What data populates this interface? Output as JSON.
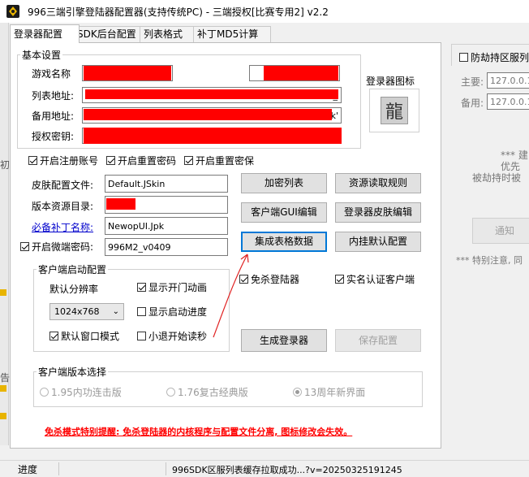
{
  "window": {
    "title": "996三端引擎登陆器配置器(支持传统PC) - 三端授权[比赛专用2] v2.2"
  },
  "tabs": [
    "登录器配置",
    "SDK后台配置",
    "列表格式",
    "补丁MD5计算"
  ],
  "basic": {
    "legend": "基本设置",
    "game_name_label": "游戏名称",
    "list_url_label": "列表地址:",
    "backup_url_label": "备用地址:",
    "auth_key_label": "授权密钥:",
    "icon_label": "登录器图标",
    "icon_glyph": "龍",
    "backup_url_tail": "k'",
    "list_url_tail": "_"
  },
  "checks_top": [
    {
      "label": "开启注册账号",
      "checked": true
    },
    {
      "label": "开启重置密码",
      "checked": true
    },
    {
      "label": "开启重置密保",
      "checked": true
    }
  ],
  "fields": {
    "skin_label": "皮肤配置文件:",
    "skin_value": "Default.JSkin",
    "res_label": "版本资源目录:",
    "patch_label": "必备补丁名称:",
    "patch_value": "NewopUI.Jpk",
    "micro_label": "开启微端密码:",
    "micro_value": "996M2_v0409",
    "micro_checked": true
  },
  "buttons": {
    "encrypt_list": "加密列表",
    "resource_rules": "资源读取规则",
    "gui_edit": "客户端GUI编辑",
    "skin_edit": "登录器皮肤编辑",
    "integrate_table": "集成表格数据",
    "plugin_default": "内挂默认配置",
    "generate": "生成登录器",
    "save_config": "保存配置"
  },
  "checks_right": [
    {
      "label": "免杀登陆器",
      "checked": true
    },
    {
      "label": "实名认证客户端",
      "checked": true
    }
  ],
  "startup": {
    "legend": "客户端启动配置",
    "resolution_label": "默认分辨率",
    "resolution_value": "1024x768",
    "window_mode": {
      "label": "默认窗口模式",
      "checked": true
    },
    "show_anim": {
      "label": "显示开门动画",
      "checked": true
    },
    "show_progress": {
      "label": "显示启动进度",
      "checked": false
    },
    "quick_exit": {
      "label": "小退开始读秒",
      "checked": false
    }
  },
  "version_select": {
    "legend": "客户端版本选择",
    "options": [
      "1.95内功连击版",
      "1.76复古经典版",
      "13周年新界面"
    ],
    "selected_index": 2
  },
  "warning": "免杀模式特别提醒: 免杀登陆器的内核程序与配置文件分离, 图标修改会失效。",
  "right_panel": {
    "anti_hijack_label": "防劫持区服列",
    "primary_label": "主要:",
    "primary_value": "127.0.0.1",
    "backup_label": "备用:",
    "backup_value": "127.0.0.1",
    "note_line1": "*** 建",
    "note_line2": "优先",
    "note_line3": "被劫持时被",
    "notify_button": "通知",
    "special_note": "*** 特别注意, 同"
  },
  "left_edge": {
    "text1": "初",
    "text2": "告"
  },
  "status": {
    "progress_label": "进度",
    "message": "996SDK区服列表缓存拉取成功...?v=20250325191245"
  },
  "colors": {
    "redact": "#ff0000",
    "warning": "#ff0000",
    "link": "#0000cc",
    "focus": "#0078d7",
    "arrow": "#e02020"
  }
}
